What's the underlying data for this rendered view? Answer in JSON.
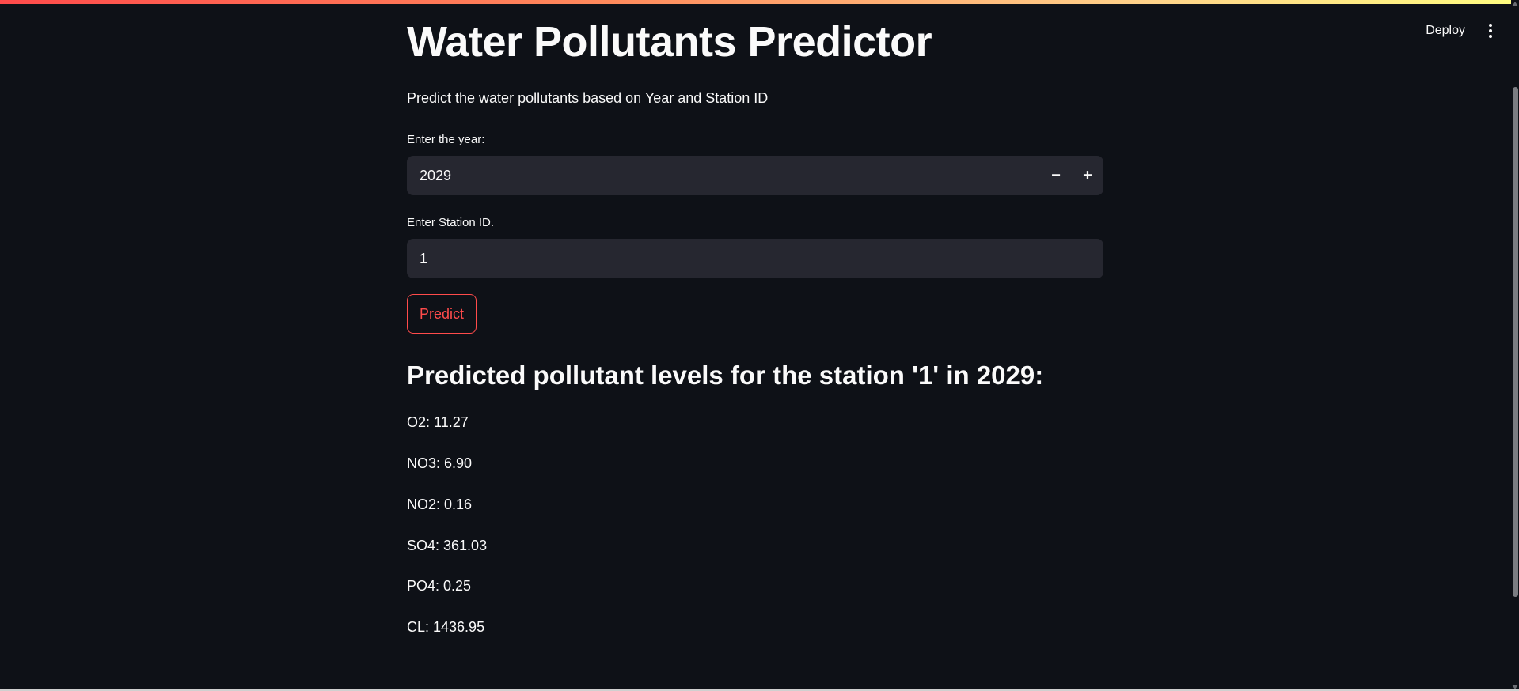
{
  "header": {
    "deploy_label": "Deploy",
    "menu_icon": "kebab-menu-icon"
  },
  "main": {
    "title": "Water Pollutants Predictor",
    "subtitle": "Predict the water pollutants based on Year and Station ID",
    "year_field": {
      "label": "Enter the year:",
      "value": "2029",
      "decrement_label": "−",
      "increment_label": "+"
    },
    "station_field": {
      "label": "Enter Station ID.",
      "value": "1"
    },
    "predict_label": "Predict",
    "result_heading": "Predicted pollutant levels for the station '1' in 2029:",
    "results": [
      "O2: 11.27",
      "NO3: 6.90",
      "NO2: 0.16",
      "SO4: 361.03",
      "PO4: 0.25",
      "CL: 1436.95"
    ]
  },
  "colors": {
    "background": "#0e1117",
    "input_background": "#262730",
    "accent": "#ff4b4b",
    "text": "#fafafa"
  }
}
